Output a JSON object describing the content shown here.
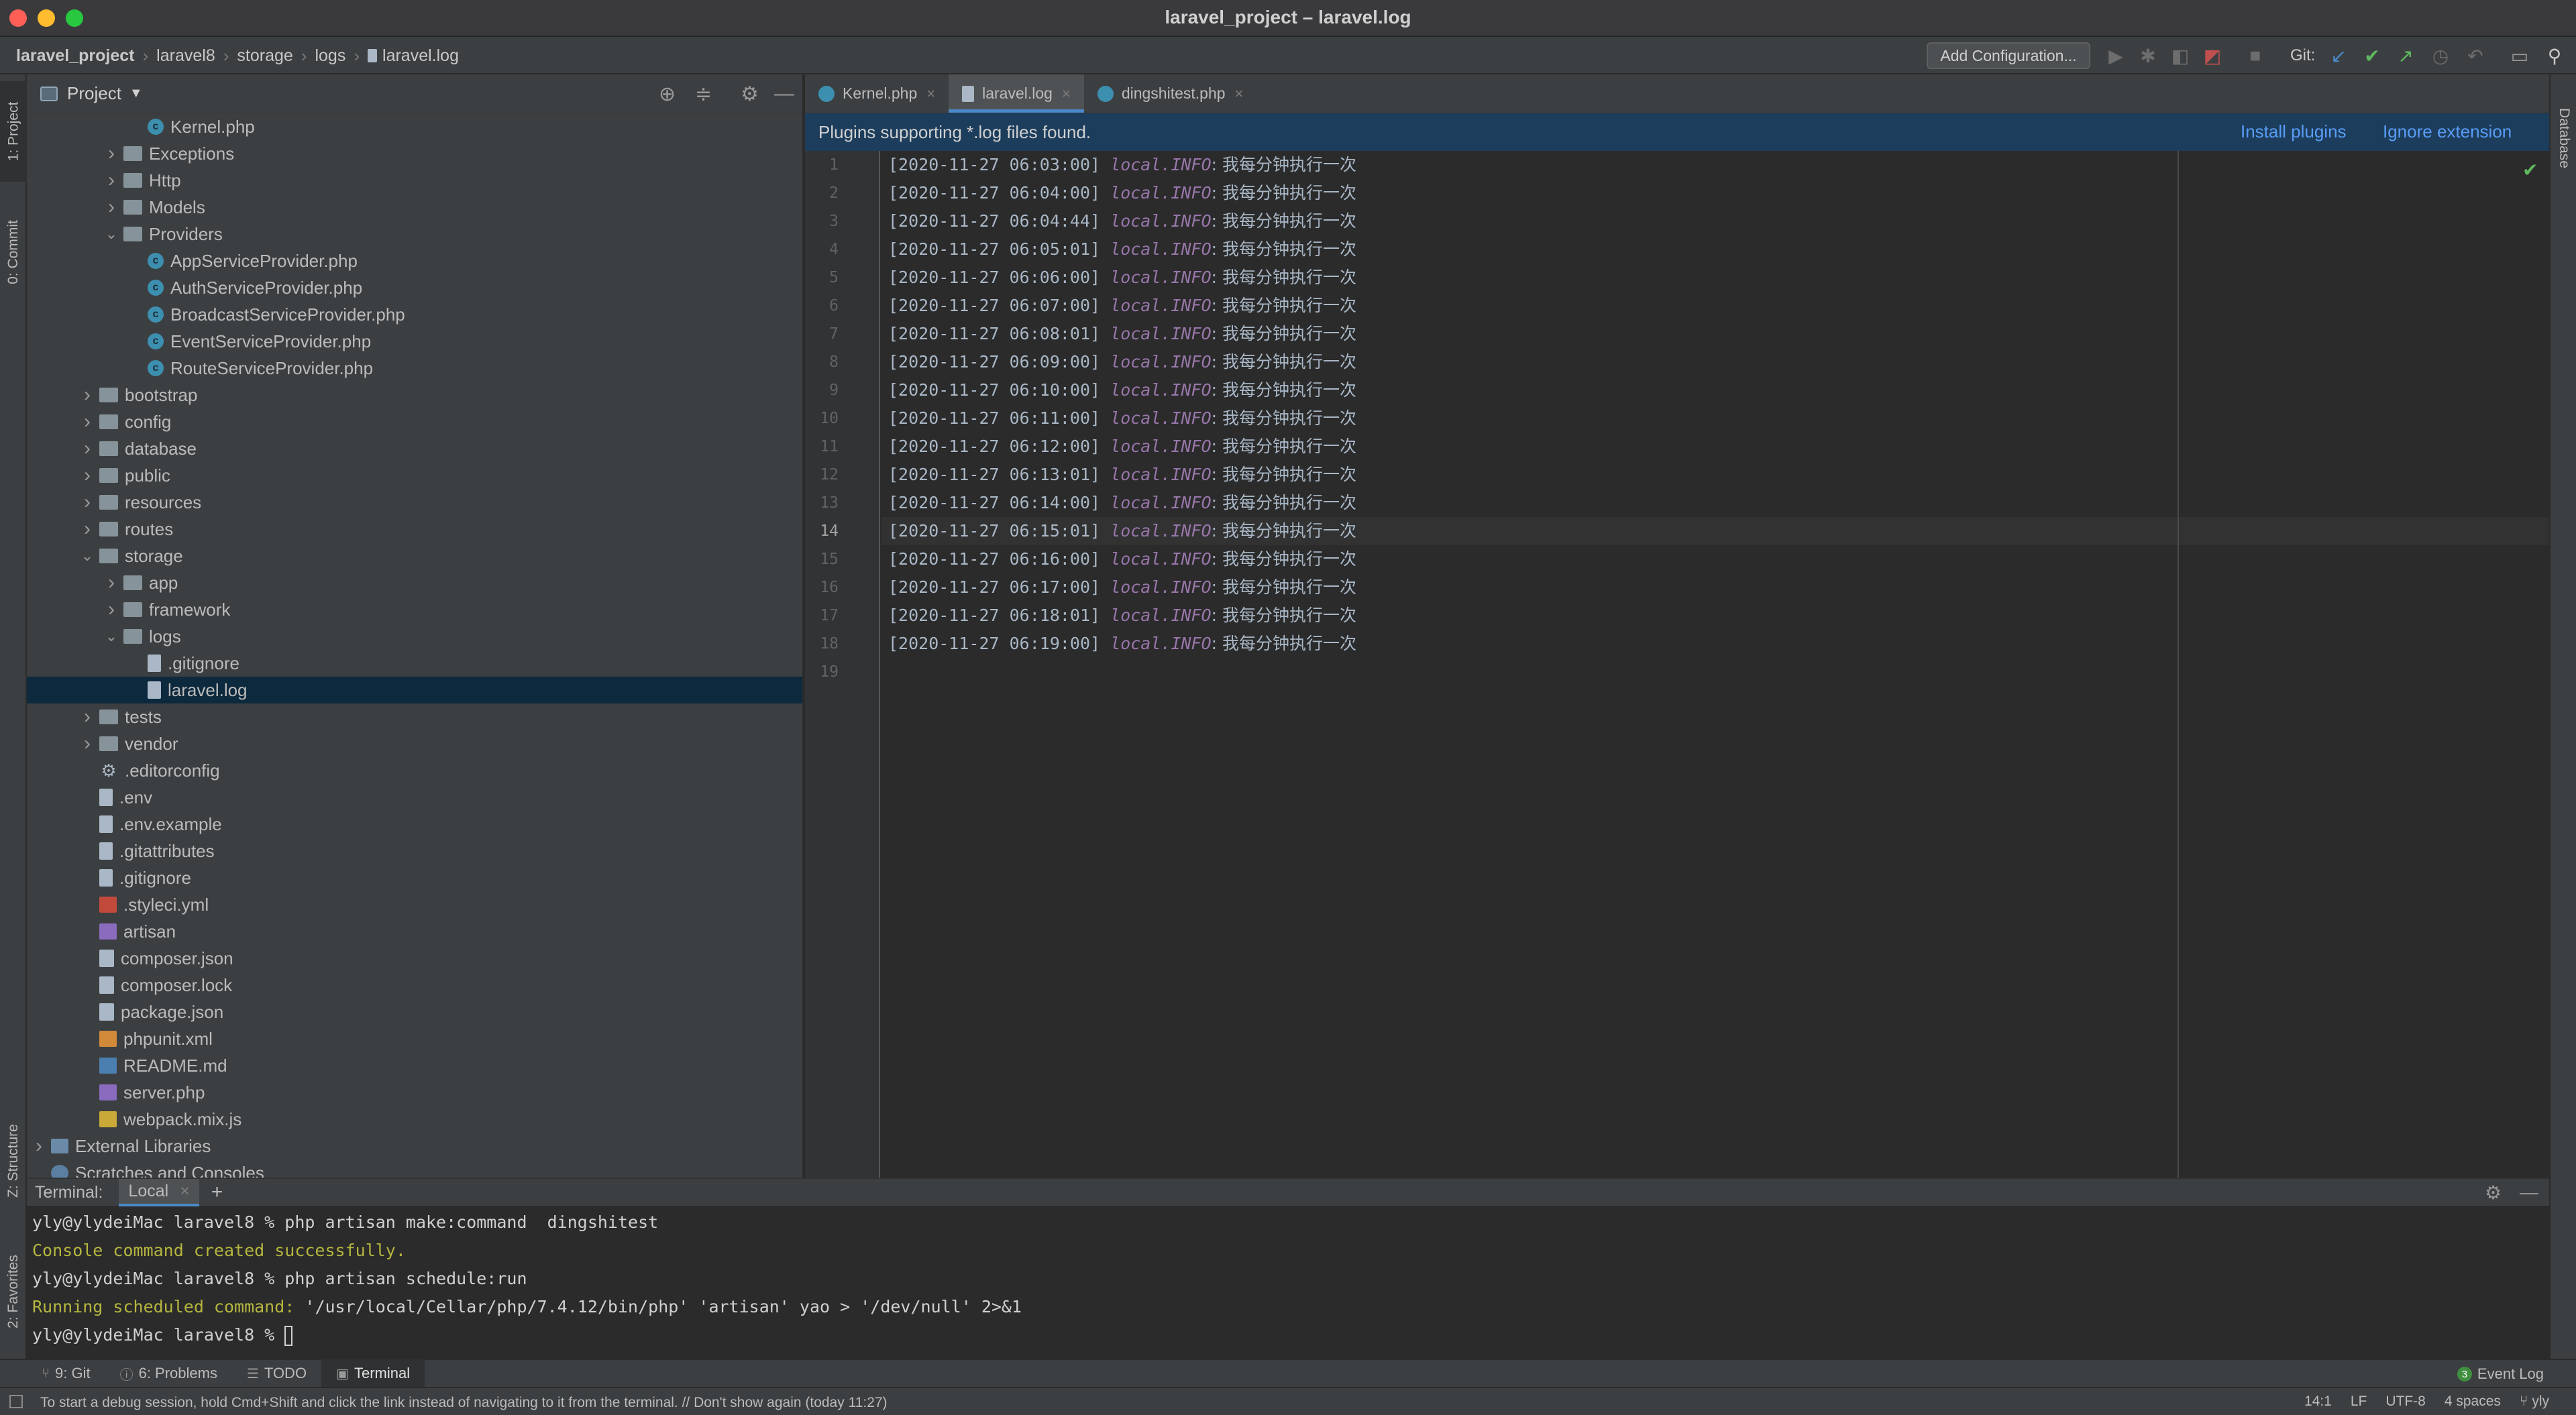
{
  "window": {
    "title": "laravel_project – laravel.log"
  },
  "breadcrumb": [
    "laravel_project",
    "laravel8",
    "storage",
    "logs",
    "laravel.log"
  ],
  "toolbar": {
    "add_configuration": "Add Configuration...",
    "git_label": "Git:"
  },
  "left_strip": {
    "project": "1: Project",
    "commit": "0: Commit",
    "structure": "Z: Structure",
    "favorites": "2: Favorites"
  },
  "right_strip": {
    "database": "Database"
  },
  "project_panel": {
    "title": "Project",
    "tree": [
      {
        "label": "Kernel.php",
        "icon": "php-class",
        "depth": 4
      },
      {
        "label": "Exceptions",
        "icon": "folder",
        "depth": 3,
        "arrow": "closed"
      },
      {
        "label": "Http",
        "icon": "folder",
        "depth": 3,
        "arrow": "closed"
      },
      {
        "label": "Models",
        "icon": "folder",
        "depth": 3,
        "arrow": "closed"
      },
      {
        "label": "Providers",
        "icon": "folder",
        "depth": 3,
        "arrow": "open"
      },
      {
        "label": "AppServiceProvider.php",
        "icon": "php-class",
        "depth": 4
      },
      {
        "label": "AuthServiceProvider.php",
        "icon": "php-class",
        "depth": 4
      },
      {
        "label": "BroadcastServiceProvider.php",
        "icon": "php-class",
        "depth": 4
      },
      {
        "label": "EventServiceProvider.php",
        "icon": "php-class",
        "depth": 4
      },
      {
        "label": "RouteServiceProvider.php",
        "icon": "php-class",
        "depth": 4
      },
      {
        "label": "bootstrap",
        "icon": "folder",
        "depth": 2,
        "arrow": "closed"
      },
      {
        "label": "config",
        "icon": "folder",
        "depth": 2,
        "arrow": "closed"
      },
      {
        "label": "database",
        "icon": "folder",
        "depth": 2,
        "arrow": "closed"
      },
      {
        "label": "public",
        "icon": "folder",
        "depth": 2,
        "arrow": "closed"
      },
      {
        "label": "resources",
        "icon": "folder",
        "depth": 2,
        "arrow": "closed"
      },
      {
        "label": "routes",
        "icon": "folder",
        "depth": 2,
        "arrow": "closed"
      },
      {
        "label": "storage",
        "icon": "folder",
        "depth": 2,
        "arrow": "open"
      },
      {
        "label": "app",
        "icon": "folder",
        "depth": 3,
        "arrow": "closed"
      },
      {
        "label": "framework",
        "icon": "folder",
        "depth": 3,
        "arrow": "closed"
      },
      {
        "label": "logs",
        "icon": "folder",
        "depth": 3,
        "arrow": "open"
      },
      {
        "label": ".gitignore",
        "icon": "file",
        "depth": 4
      },
      {
        "label": "laravel.log",
        "icon": "file",
        "depth": 4,
        "selected": true
      },
      {
        "label": "tests",
        "icon": "folder",
        "depth": 2,
        "arrow": "closed"
      },
      {
        "label": "vendor",
        "icon": "folder",
        "depth": 2,
        "arrow": "closed"
      },
      {
        "label": ".editorconfig",
        "icon": "gear",
        "depth": 2
      },
      {
        "label": ".env",
        "icon": "file",
        "depth": 2
      },
      {
        "label": ".env.example",
        "icon": "file",
        "depth": 2
      },
      {
        "label": ".gitattributes",
        "icon": "file",
        "depth": 2
      },
      {
        "label": ".gitignore",
        "icon": "file",
        "depth": 2
      },
      {
        "label": ".styleci.yml",
        "icon": "yml",
        "depth": 2
      },
      {
        "label": "artisan",
        "icon": "artisan",
        "depth": 2
      },
      {
        "label": "composer.json",
        "icon": "json",
        "depth": 2
      },
      {
        "label": "composer.lock",
        "icon": "json",
        "depth": 2
      },
      {
        "label": "package.json",
        "icon": "json",
        "depth": 2
      },
      {
        "label": "phpunit.xml",
        "icon": "xml",
        "depth": 2
      },
      {
        "label": "README.md",
        "icon": "md",
        "depth": 2
      },
      {
        "label": "server.php",
        "icon": "artisan",
        "depth": 2
      },
      {
        "label": "webpack.mix.js",
        "icon": "js",
        "depth": 2
      },
      {
        "label": "External Libraries",
        "icon": "lib",
        "depth": 0,
        "arrow": "closed"
      },
      {
        "label": "Scratches and Consoles",
        "icon": "scratch",
        "depth": 0
      }
    ]
  },
  "editor": {
    "tabs": [
      {
        "label": "Kernel.php",
        "icon": "php-class",
        "active": false
      },
      {
        "label": "laravel.log",
        "icon": "file",
        "active": true
      },
      {
        "label": "dingshitest.php",
        "icon": "php-class",
        "active": false
      }
    ],
    "banner": {
      "message": "Plugins supporting *.log files found.",
      "install": "Install plugins",
      "ignore": "Ignore extension"
    },
    "current_line": 14,
    "lines": [
      {
        "ts": "[2020-11-27 06:03:00]",
        "level": "local.INFO",
        "msg": ": 我每分钟执行一次"
      },
      {
        "ts": "[2020-11-27 06:04:00]",
        "level": "local.INFO",
        "msg": ": 我每分钟执行一次"
      },
      {
        "ts": "[2020-11-27 06:04:44]",
        "level": "local.INFO",
        "msg": ": 我每分钟执行一次"
      },
      {
        "ts": "[2020-11-27 06:05:01]",
        "level": "local.INFO",
        "msg": ": 我每分钟执行一次"
      },
      {
        "ts": "[2020-11-27 06:06:00]",
        "level": "local.INFO",
        "msg": ": 我每分钟执行一次"
      },
      {
        "ts": "[2020-11-27 06:07:00]",
        "level": "local.INFO",
        "msg": ": 我每分钟执行一次"
      },
      {
        "ts": "[2020-11-27 06:08:01]",
        "level": "local.INFO",
        "msg": ": 我每分钟执行一次"
      },
      {
        "ts": "[2020-11-27 06:09:00]",
        "level": "local.INFO",
        "msg": ": 我每分钟执行一次"
      },
      {
        "ts": "[2020-11-27 06:10:00]",
        "level": "local.INFO",
        "msg": ": 我每分钟执行一次"
      },
      {
        "ts": "[2020-11-27 06:11:00]",
        "level": "local.INFO",
        "msg": ": 我每分钟执行一次"
      },
      {
        "ts": "[2020-11-27 06:12:00]",
        "level": "local.INFO",
        "msg": ": 我每分钟执行一次"
      },
      {
        "ts": "[2020-11-27 06:13:01]",
        "level": "local.INFO",
        "msg": ": 我每分钟执行一次"
      },
      {
        "ts": "[2020-11-27 06:14:00]",
        "level": "local.INFO",
        "msg": ": 我每分钟执行一次"
      },
      {
        "ts": "[2020-11-27 06:15:01]",
        "level": "local.INFO",
        "msg": ": 我每分钟执行一次"
      },
      {
        "ts": "[2020-11-27 06:16:00]",
        "level": "local.INFO",
        "msg": ": 我每分钟执行一次"
      },
      {
        "ts": "[2020-11-27 06:17:00]",
        "level": "local.INFO",
        "msg": ": 我每分钟执行一次"
      },
      {
        "ts": "[2020-11-27 06:18:01]",
        "level": "local.INFO",
        "msg": ": 我每分钟执行一次"
      },
      {
        "ts": "[2020-11-27 06:19:00]",
        "level": "local.INFO",
        "msg": ": 我每分钟执行一次"
      },
      {
        "ts": "",
        "level": "",
        "msg": ""
      }
    ]
  },
  "terminal": {
    "label": "Terminal:",
    "tab": "Local",
    "lines": [
      {
        "text": "yly@ylydeiMac laravel8 % php artisan make:command  dingshitest",
        "prefix": ""
      },
      {
        "text": "Console command created successfully.",
        "prefix": "",
        "yellow": true
      },
      {
        "text": "yly@ylydeiMac laravel8 % php artisan schedule:run",
        "prefix": ""
      },
      {
        "prefix": "Running scheduled command:",
        "text": " '/usr/local/Cellar/php/7.4.12/bin/php' 'artisan' yao > '/dev/null' 2>&1"
      },
      {
        "text": "yly@ylydeiMac laravel8 % ",
        "prefix": "",
        "cursor": true
      }
    ]
  },
  "tool_windows": [
    {
      "label": "9: Git",
      "icon": "git-branch-icon",
      "active": false
    },
    {
      "label": "6: Problems",
      "icon": "problems-icon",
      "active": false
    },
    {
      "label": "TODO",
      "icon": "todo-icon",
      "active": false
    },
    {
      "label": "Terminal",
      "icon": "terminal-icon",
      "active": true
    }
  ],
  "event_log": {
    "count": "3",
    "label": "Event Log"
  },
  "status": {
    "message": "To start a debug session, hold Cmd+Shift and click the link instead of navigating to it from the terminal. // Don't show again (today 11:27)",
    "position": "14:1",
    "line_sep": "LF",
    "encoding": "UTF-8",
    "indent": "4 spaces",
    "user": "yly"
  },
  "colors": {
    "accent": "#4a88c7",
    "selection": "#0d293e",
    "banner": "#1d3d5c",
    "link": "#589df6",
    "log_level": "#9876aa",
    "terminal_yellow": "#b5b63f"
  }
}
